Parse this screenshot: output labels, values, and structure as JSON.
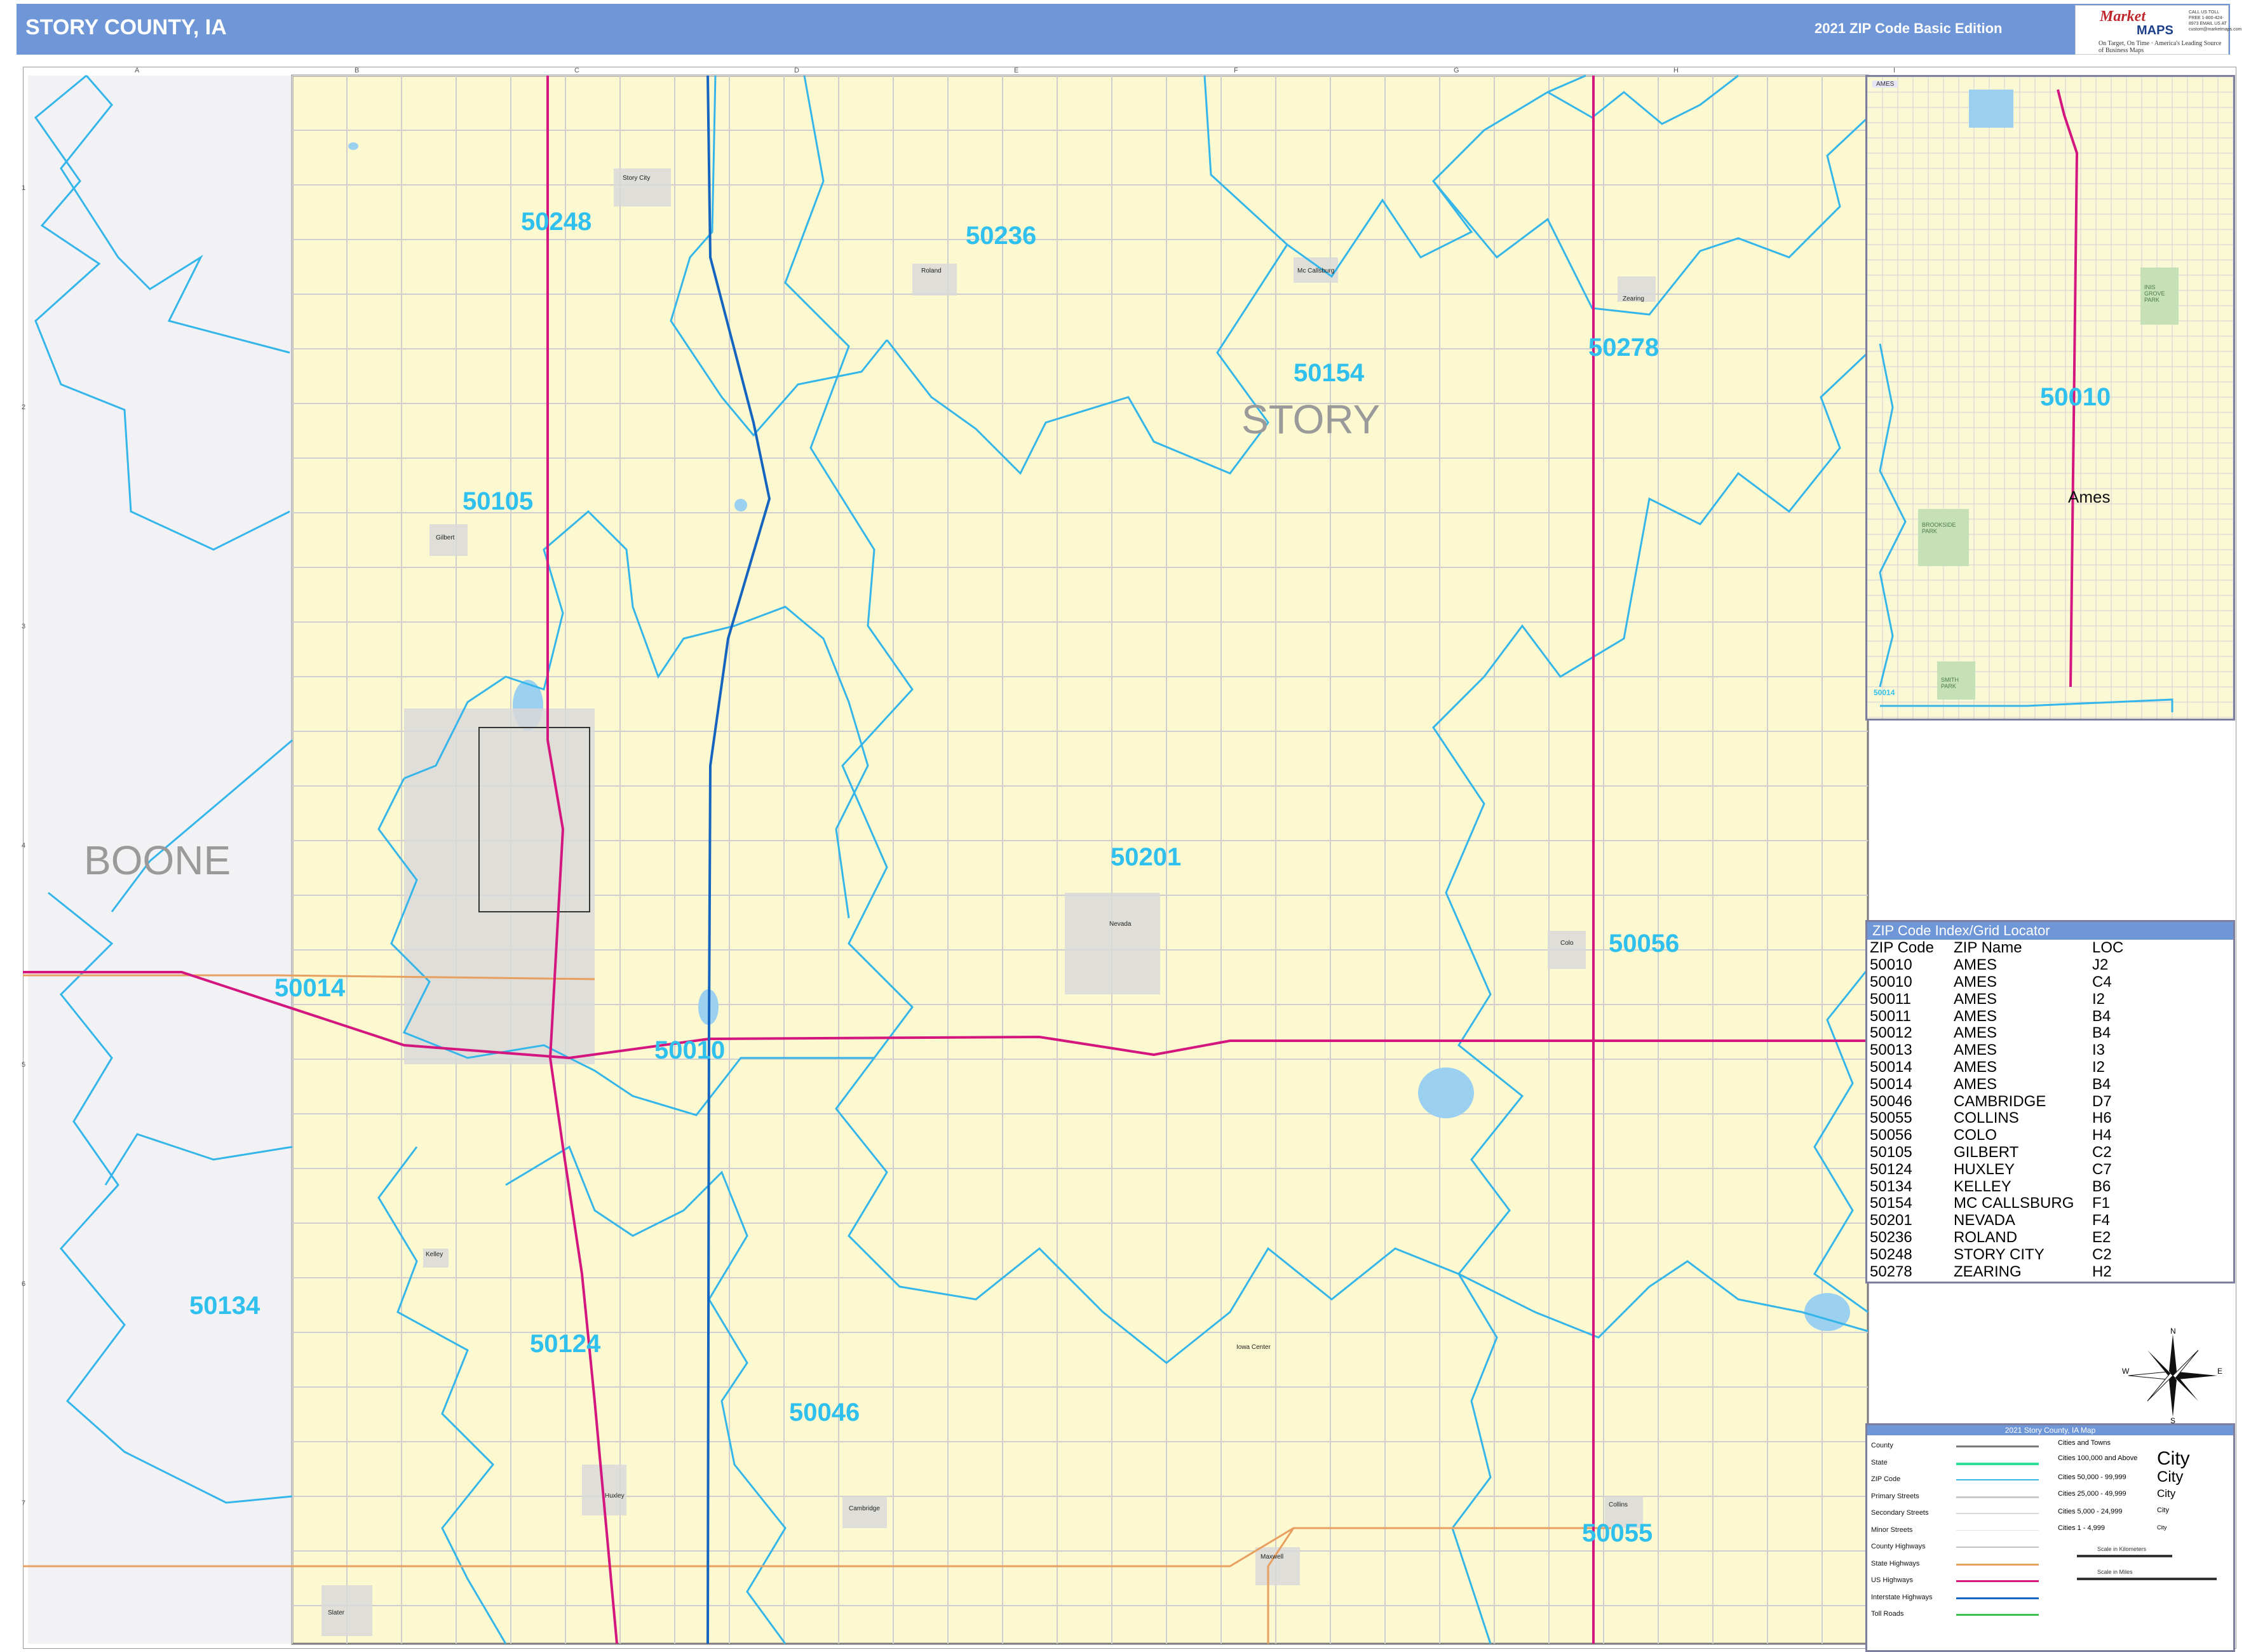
{
  "header": {
    "title": "STORY COUNTY, IA",
    "edition": "2021 ZIP Code Basic Edition",
    "logo": {
      "brand_top": "Market",
      "brand_bottom": "MAPS",
      "tagline_1": "On Target, On Time",
      "tagline_2": "America's Leading Source of Business Maps",
      "contact": "CALL US TOLL FREE 1-800-424-8973 EMAIL US AT custom@marketmaps.com"
    }
  },
  "map": {
    "counties": [
      {
        "name": "STORY"
      },
      {
        "name": "BOONE"
      }
    ],
    "zip_labels": [
      "50248",
      "50236",
      "50154",
      "50278",
      "50105",
      "50201",
      "50056",
      "50014",
      "50010",
      "50134",
      "50124",
      "50046",
      "50055"
    ],
    "towns": [
      "Story City",
      "Roland",
      "Mc Callsburg",
      "Zearing",
      "Gilbert",
      "Nevada",
      "Colo",
      "Kelley",
      "Iowa Center",
      "Huxley",
      "Cambridge",
      "Maxwell",
      "Collins",
      "Slater"
    ],
    "grid_columns": [
      "A",
      "B",
      "C",
      "D",
      "E",
      "F",
      "G",
      "H",
      "I"
    ],
    "grid_rows": [
      "1",
      "2",
      "3",
      "4",
      "5",
      "6",
      "7"
    ],
    "colors": {
      "land": "#fcf8d0",
      "boone": "#f2f2f4",
      "zip_boundary": "#35b6ea",
      "us_highway": "#d4167f",
      "interstate": "#1565c0",
      "state_highway": "#e8a060",
      "roads": "#c8c8c8",
      "water": "#9bd0f0",
      "county_line": "#7a7a7a"
    }
  },
  "inset": {
    "tag": "AMES",
    "zip_label": "50010",
    "zip_label_2": "50014",
    "city": "Ames",
    "parks": [
      "INIS GROVE PARK",
      "BROOKSIDE PARK",
      "SMITH PARK"
    ]
  },
  "zip_index": {
    "title": "ZIP Code Index/Grid Locator",
    "headers": [
      "ZIP Code",
      "ZIP Name",
      "LOC"
    ],
    "rows": [
      [
        "50010",
        "AMES",
        "J2"
      ],
      [
        "50010",
        "AMES",
        "C4"
      ],
      [
        "50011",
        "AMES",
        "I2"
      ],
      [
        "50011",
        "AMES",
        "B4"
      ],
      [
        "50012",
        "AMES",
        "B4"
      ],
      [
        "50013",
        "AMES",
        "I3"
      ],
      [
        "50014",
        "AMES",
        "I2"
      ],
      [
        "50014",
        "AMES",
        "B4"
      ],
      [
        "50046",
        "CAMBRIDGE",
        "D7"
      ],
      [
        "50055",
        "COLLINS",
        "H6"
      ],
      [
        "50056",
        "COLO",
        "H4"
      ],
      [
        "50105",
        "GILBERT",
        "C2"
      ],
      [
        "50124",
        "HUXLEY",
        "C7"
      ],
      [
        "50134",
        "KELLEY",
        "B6"
      ],
      [
        "50154",
        "MC CALLSBURG",
        "F1"
      ],
      [
        "50201",
        "NEVADA",
        "F4"
      ],
      [
        "50236",
        "ROLAND",
        "E2"
      ],
      [
        "50248",
        "STORY CITY",
        "C2"
      ],
      [
        "50278",
        "ZEARING",
        "H2"
      ]
    ]
  },
  "compass": {
    "n": "N",
    "s": "S",
    "e": "E",
    "w": "W"
  },
  "legend": {
    "title": "2021 Story County, IA Map",
    "cities_header": "Cities and Towns",
    "items": [
      "County",
      "State",
      "ZIP Code",
      "Primary Streets",
      "Secondary Streets",
      "Minor Streets",
      "County Highways",
      "State Highways",
      "US Highways",
      "Interstate Highways",
      "Toll Roads"
    ],
    "city_classes": [
      "Cities 100,000 and Above",
      "Cities 50,000 - 99,999",
      "Cities 25,000 - 49,999",
      "Cities 5,000 - 24,999",
      "Cities 1 - 4,999"
    ],
    "city_word": "City",
    "scale_km": "Scale in Kilometers",
    "scale_mi": "Scale in Miles"
  }
}
